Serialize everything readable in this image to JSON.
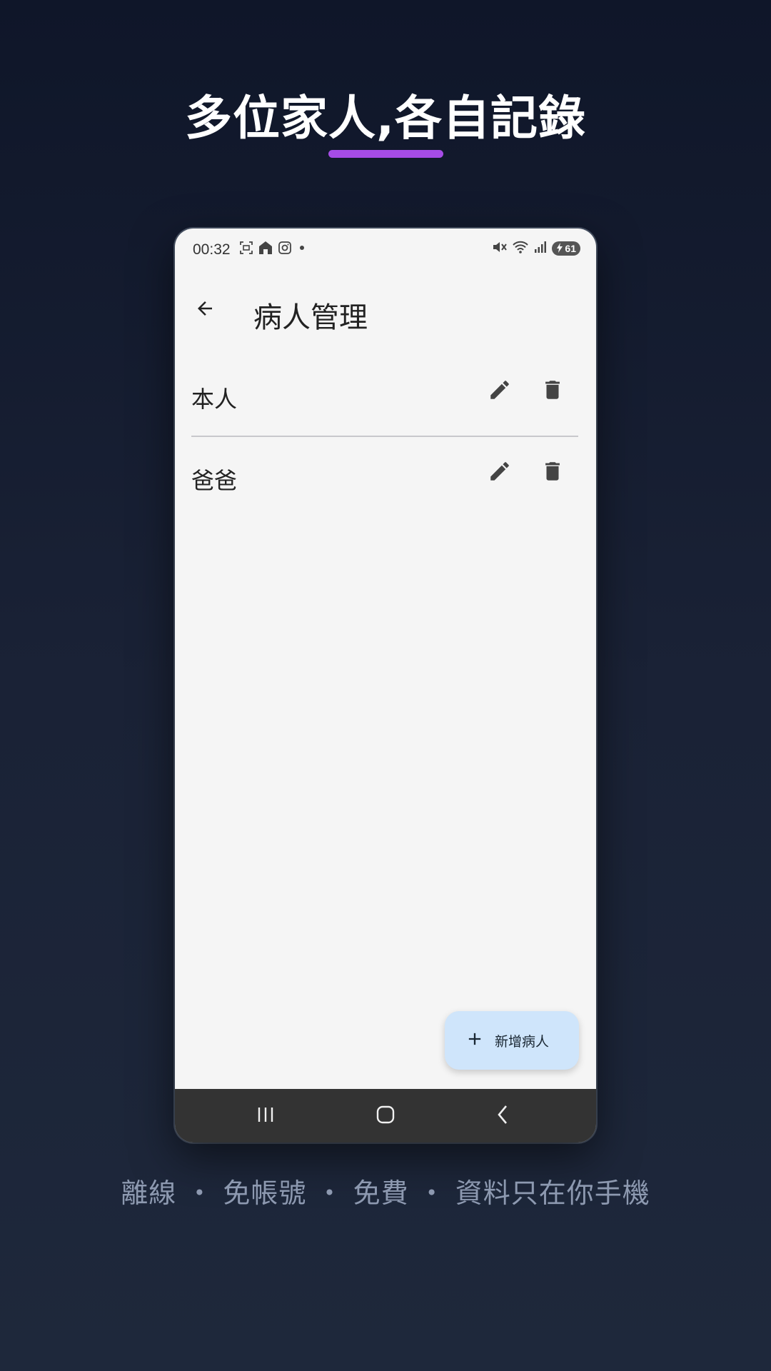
{
  "promo": {
    "headline": "多位家人,各自記錄",
    "tagline": "離線 ・ 免帳號 ・ 免費 ・ 資料只在你手機"
  },
  "statusbar": {
    "time": "00:32",
    "battery": "61"
  },
  "appbar": {
    "title": "病人管理"
  },
  "patients": [
    {
      "name": "本人"
    },
    {
      "name": "爸爸"
    }
  ],
  "fab": {
    "label": "新增病人"
  },
  "colors": {
    "accent_underline": "#a64ce6",
    "fab_background": "#cfe5fb",
    "navbar": "#333333"
  }
}
